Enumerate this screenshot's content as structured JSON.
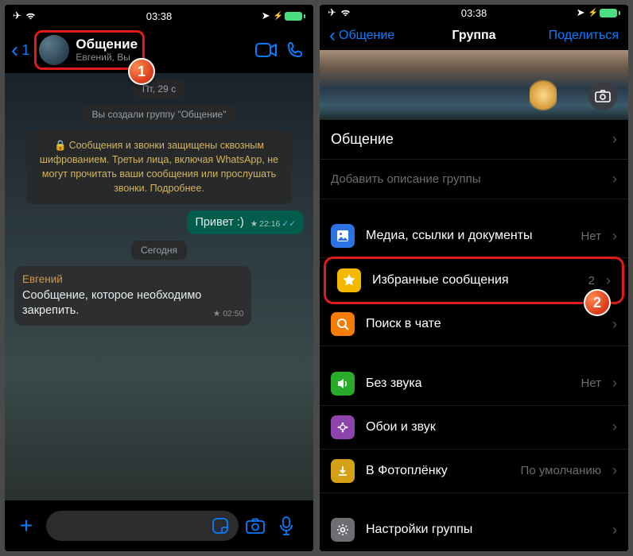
{
  "status": {
    "time": "03:38"
  },
  "left": {
    "back_count": "1",
    "chat_title": "Общение",
    "chat_subtitle": "Евгений, Вы",
    "date_label": "Пт, 29 с",
    "system_message": "Вы создали группу \"Общение\"",
    "encryption_notice": "Сообщения и звонки защищены сквозным шифрованием. Третьи лица, включая WhatsApp, не могут прочитать ваши сообщения или прослушать звонки. Подробнее.",
    "outgoing": {
      "text": "Привет :)",
      "time": "22:16"
    },
    "today_label": "Сегодня",
    "incoming": {
      "sender": "Евгений",
      "text": "Сообщение, которое необходимо закрепить.",
      "time": "02:50"
    },
    "step": "1"
  },
  "right": {
    "back_label": "Общение",
    "title": "Группа",
    "share": "Поделиться",
    "group_name": "Общение",
    "add_description": "Добавить описание группы",
    "rows": {
      "media": {
        "label": "Медиа, ссылки и документы",
        "value": "Нет"
      },
      "starred": {
        "label": "Избранные сообщения",
        "value": "2"
      },
      "search": {
        "label": "Поиск в чате"
      },
      "mute": {
        "label": "Без звука",
        "value": "Нет"
      },
      "wallpaper": {
        "label": "Обои и звук"
      },
      "save": {
        "label": "В Фотоплёнку",
        "value": "По умолчанию"
      },
      "settings": {
        "label": "Настройки группы"
      }
    },
    "step": "2"
  }
}
